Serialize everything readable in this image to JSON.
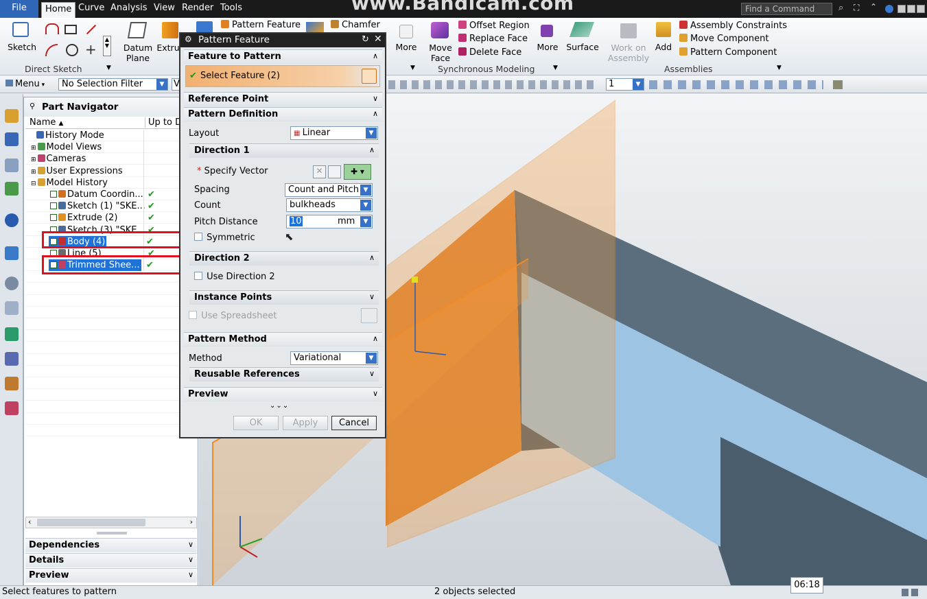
{
  "watermark": "www.Bandicam.com",
  "menubar": {
    "file": "File",
    "tabs": [
      "Home",
      "Curve",
      "Analysis",
      "View",
      "Render",
      "Tools"
    ],
    "find_command_placeholder": "Find a Command"
  },
  "ribbon": {
    "sketch": "Sketch",
    "direct_sketch": "Direct Sketch",
    "datum_plane_1": "Datum",
    "datum_plane_2": "Plane",
    "extrude": "Extru",
    "pattern_feature": "Pattern Feature",
    "chamfer": "Chamfer",
    "more_1": "More",
    "move_face_1": "Move",
    "move_face_2": "Face",
    "offset_region": "Offset Region",
    "replace_face": "Replace Face",
    "delete_face": "Delete Face",
    "more_2": "More",
    "surface": "Surface",
    "synchronous_modeling": "Synchronous Modeling",
    "work_on_assembly_1": "Work on",
    "work_on_assembly_2": "Assembly",
    "add": "Add",
    "assembly_constraints": "Assembly Constraints",
    "move_component": "Move Component",
    "pattern_component": "Pattern Component",
    "assemblies": "Assemblies"
  },
  "selection_bar": {
    "menu": "Menu",
    "filter": "No Selection Filter",
    "filter2": "V",
    "count_field": "1"
  },
  "navigator": {
    "title": "Part Navigator",
    "col_name": "Name",
    "col_uptodate": "Up to D",
    "rows": [
      {
        "label": "History Mode",
        "indent": 14,
        "check": ""
      },
      {
        "label": "Model Views",
        "indent": 6,
        "check": ""
      },
      {
        "label": "Cameras",
        "indent": 6,
        "check": ""
      },
      {
        "label": "User Expressions",
        "indent": 6,
        "check": ""
      },
      {
        "label": "Model History",
        "indent": 6,
        "check": ""
      },
      {
        "label": "Datum Coordin...",
        "indent": 34,
        "check": "✔"
      },
      {
        "label": "Sketch (1) \"SKE...",
        "indent": 34,
        "check": "✔"
      },
      {
        "label": "Extrude (2)",
        "indent": 34,
        "check": "✔"
      },
      {
        "label": "Sketch (3) \"SKE",
        "indent": 34,
        "check": "✔"
      },
      {
        "label": "Body (4)",
        "indent": 34,
        "check": "✔"
      },
      {
        "label": "Line (5)",
        "indent": 34,
        "check": "✔"
      },
      {
        "label": "Trimmed Shee...",
        "indent": 34,
        "check": "✔"
      }
    ],
    "panels": [
      "Dependencies",
      "Details",
      "Preview"
    ]
  },
  "dialog": {
    "title": "Pattern Feature",
    "feature_to_pattern": "Feature to Pattern",
    "select_feature": "Select Feature (2)",
    "reference_point": "Reference Point",
    "pattern_definition": "Pattern Definition",
    "layout_label": "Layout",
    "layout_value": "Linear",
    "direction1": "Direction 1",
    "specify_vector": "Specify Vector",
    "spacing_label": "Spacing",
    "spacing_value": "Count and Pitch",
    "count_label": "Count",
    "count_value": "bulkheads",
    "pitch_label": "Pitch Distance",
    "pitch_value": "10",
    "pitch_unit": "mm",
    "symmetric": "Symmetric",
    "direction2": "Direction 2",
    "use_direction2": "Use Direction 2",
    "instance_points": "Instance Points",
    "use_spreadsheet": "Use Spreadsheet",
    "pattern_method": "Pattern Method",
    "method_label": "Method",
    "method_value": "Variational",
    "reusable_references": "Reusable References",
    "preview": "Preview",
    "ok": "OK",
    "apply": "Apply",
    "cancel": "Cancel"
  },
  "status": {
    "left": "Select features to pattern",
    "center": "2 objects selected",
    "clock": "06:18"
  },
  "colors": {
    "accent": "#1e72d8",
    "highlight_box": "#e01020",
    "sheet_orange": "#f59a3c",
    "model_body": "#4e6272",
    "model_inner": "#9dc4e2"
  }
}
